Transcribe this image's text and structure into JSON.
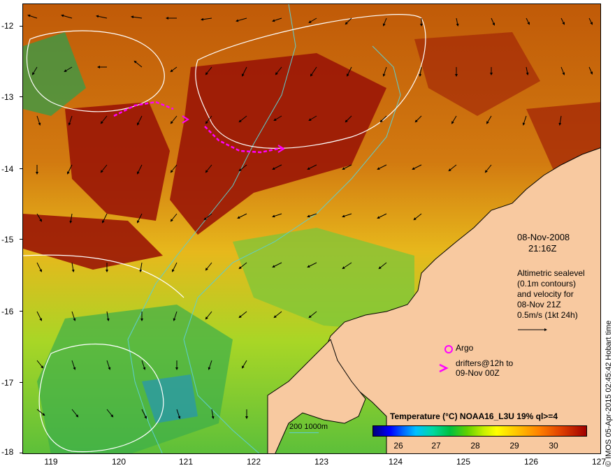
{
  "map": {
    "lon_ticks": [
      "119",
      "120",
      "121",
      "122",
      "123",
      "124",
      "125",
      "126",
      "127"
    ],
    "lat_ticks": [
      "-12",
      "-13",
      "-14",
      "-15",
      "-16",
      "-17",
      "-18"
    ],
    "colors": {
      "land": "#f8c9a0",
      "coast": "#000000",
      "isobath": "#5ecfcf",
      "sealevel_contour": "#ffffff",
      "drifter": "#ff00ff",
      "vector": "#000000"
    }
  },
  "panel": {
    "date": "08-Nov-2008",
    "time": "21:16Z",
    "altimetry_lines": [
      "Altimetric sealevel",
      "(0.1m contours)",
      "and velocity for",
      "08-Nov 21Z",
      "0.5m/s (1kt 24h)"
    ],
    "argo_label": "Argo",
    "drifter_label_1": "drifters@12h to",
    "drifter_label_2": "09-Nov 00Z"
  },
  "colorbar": {
    "title": "Temperature (°C) NOAA16_L3U 19% ql>=4",
    "ticks": [
      "26",
      "27",
      "28",
      "29",
      "30"
    ]
  },
  "depth_legend": "200  1000m",
  "credit": "© IMOS 05-Apr-2015 02:45:42 Hobart time"
}
